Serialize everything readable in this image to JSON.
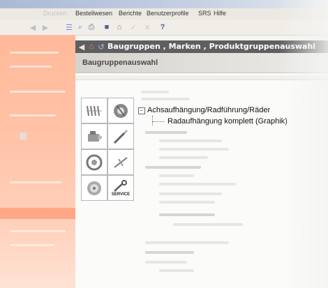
{
  "menu": {
    "items": [
      "Drucken",
      "Bestellwesen",
      "Berichte",
      "Benutzerprofile",
      "SRS",
      "Hilfe"
    ]
  },
  "navbar": {
    "title": "Baugruppen , Marken , Produktgruppenauswahl"
  },
  "main": {
    "header": "Baugruppenauswahl"
  },
  "icon_grid": {
    "service_label": "SERVICE"
  },
  "tree": {
    "expander": "−",
    "root_label": "Achsaufhängung/Radführung/Räder",
    "child_label": "Radaufhängung komplett (Graphik)"
  },
  "colors": {
    "left_panel": "#ffc3a7",
    "navbar": "#5f5f5f",
    "header": "#d6d3cd"
  }
}
